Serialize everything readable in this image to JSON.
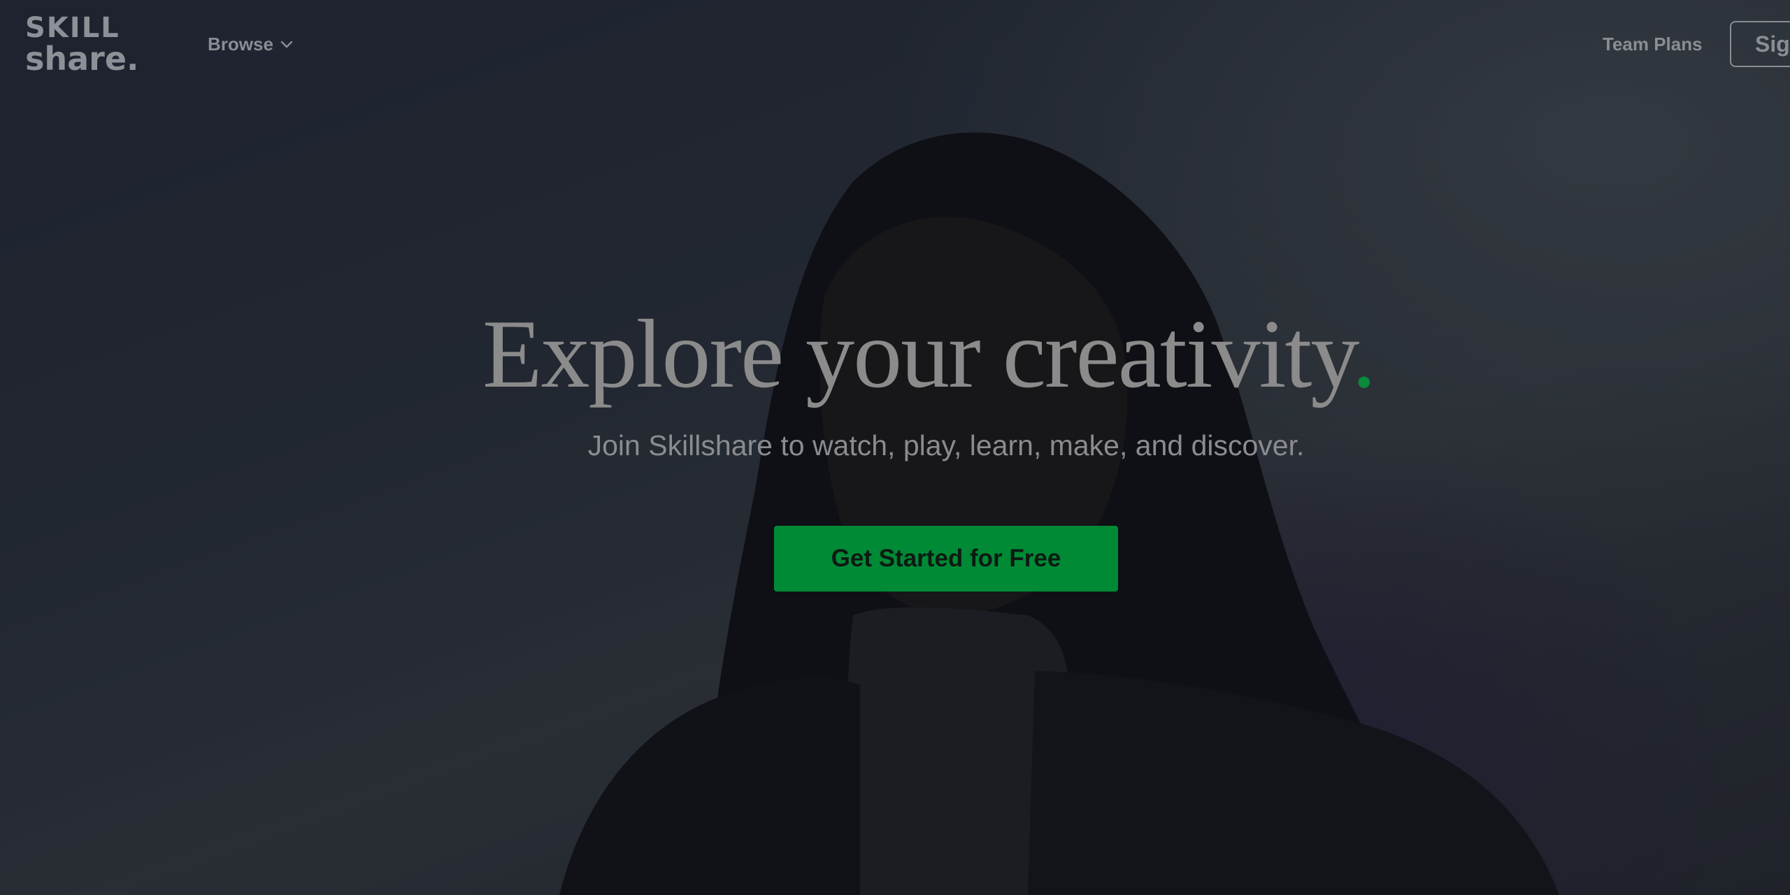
{
  "header": {
    "logo_line1": "SKILL",
    "logo_line2": "share.",
    "browse_label": "Browse",
    "team_plans_label": "Team Plans",
    "sign_in_label": "Sign In"
  },
  "hero": {
    "title": "Explore your creativity",
    "title_dot": ".",
    "subtitle": "Join Skillshare to watch, play, learn, make, and discover.",
    "cta_label": "Get Started for Free"
  },
  "colors": {
    "brand_green": "#008a36",
    "text_muted": "#8a8c90"
  }
}
